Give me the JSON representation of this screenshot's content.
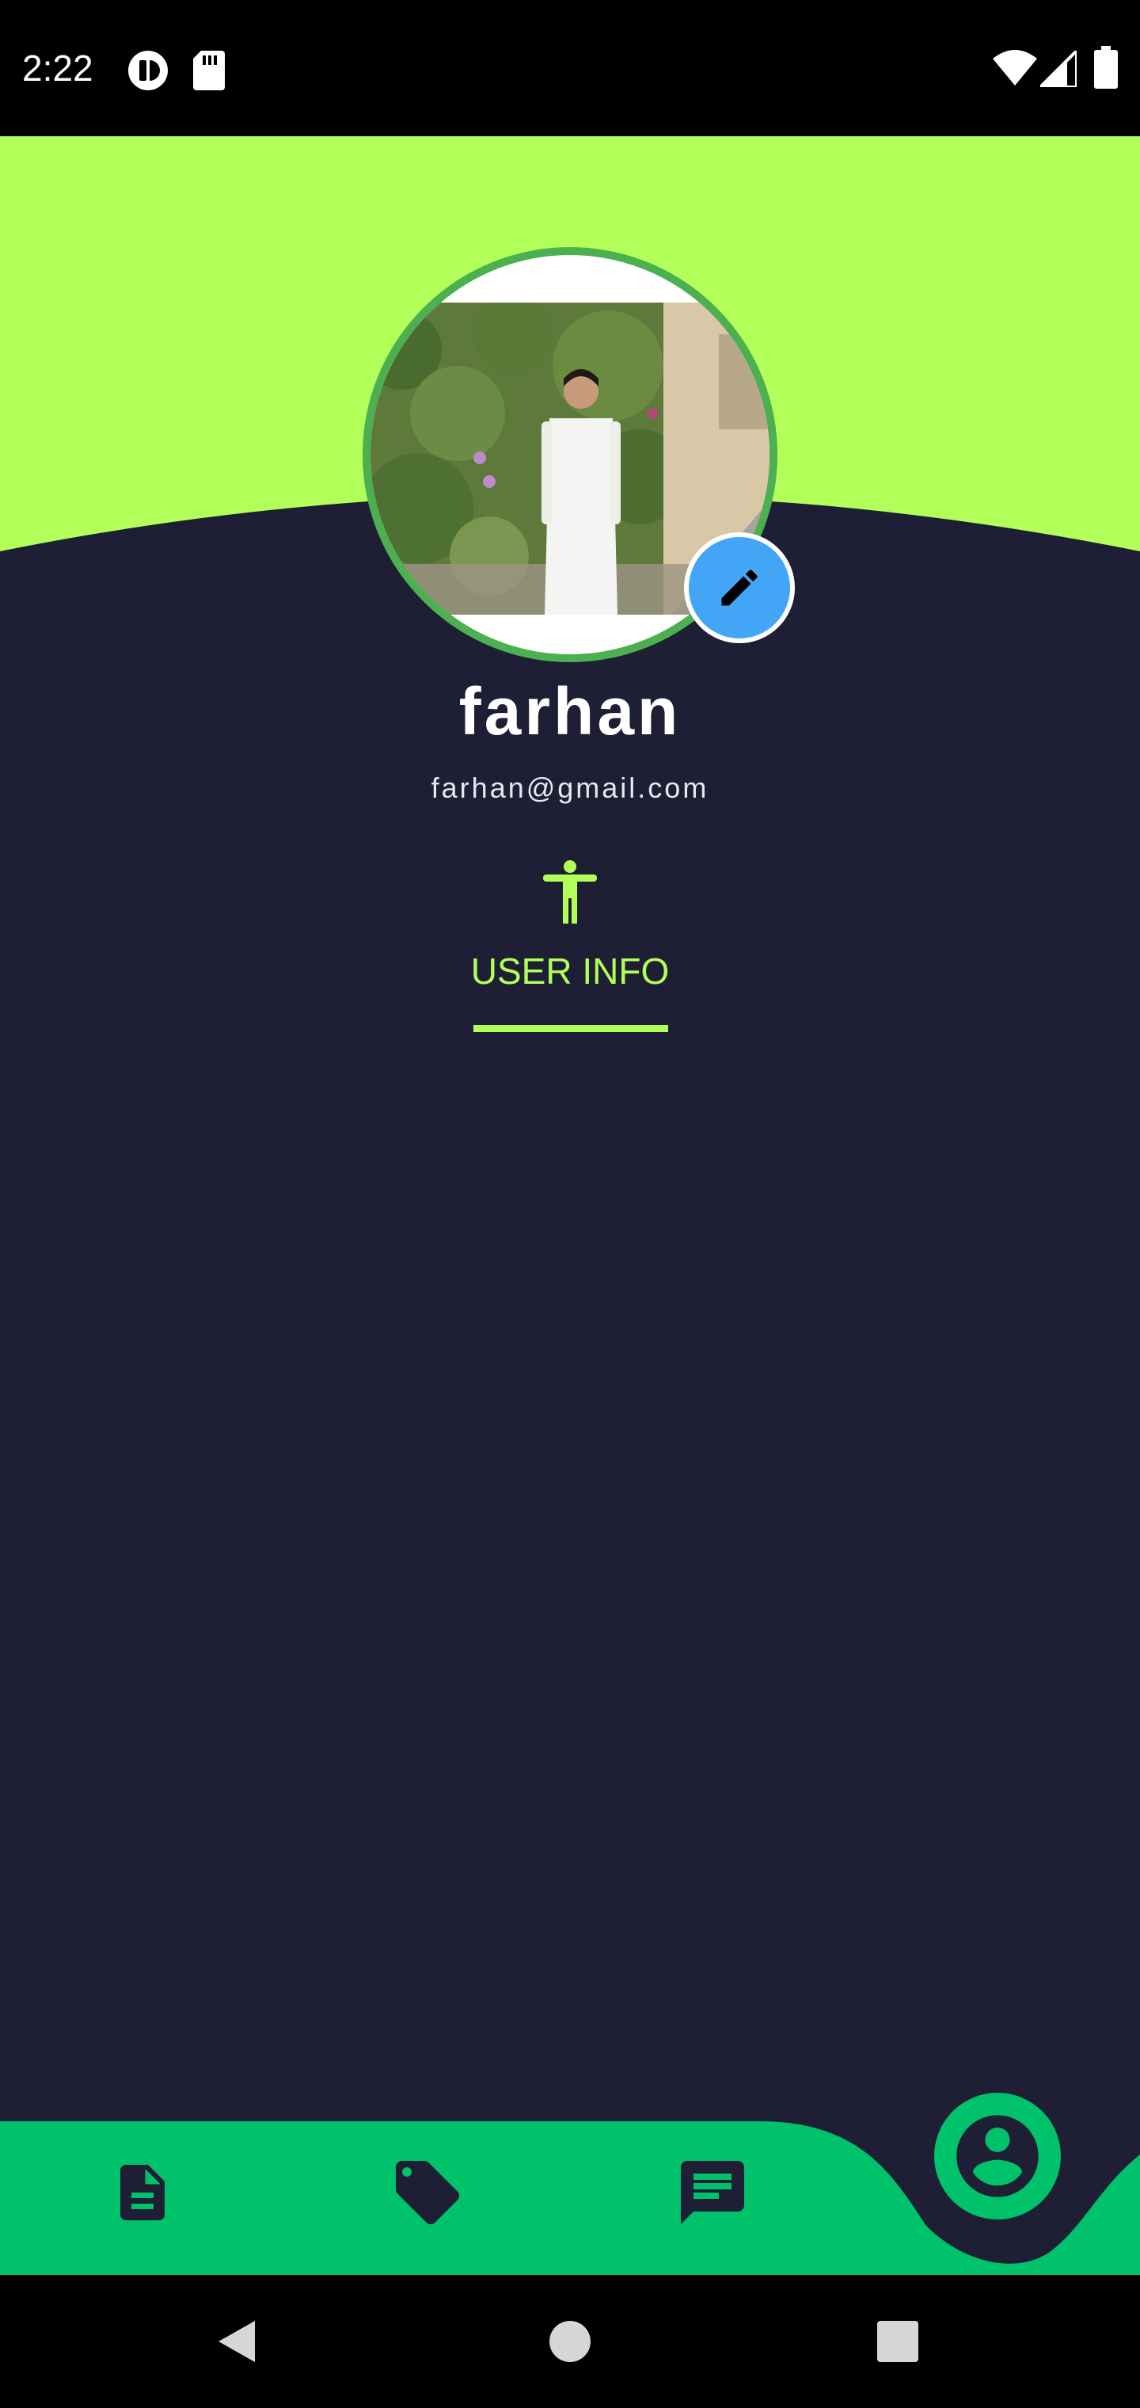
{
  "status_bar": {
    "time": "2:22",
    "left_icons": [
      "notification-circle-icon",
      "sd-card-icon"
    ],
    "right_icons": [
      "wifi-icon",
      "cell-signal-icon",
      "battery-icon"
    ]
  },
  "profile": {
    "name": "farhan",
    "email": "farhan@gmail.com",
    "avatar": "profile-photo",
    "edit_icon": "pencil-icon"
  },
  "tabs": [
    {
      "label": "USER INFO",
      "icon": "accessibility-icon",
      "selected": true
    }
  ],
  "bottom_nav": {
    "items": [
      {
        "icon": "document-icon"
      },
      {
        "icon": "tag-icon"
      },
      {
        "icon": "chat-icon"
      },
      {
        "icon": "account-circle-icon",
        "active": true
      }
    ]
  },
  "system_nav": [
    "back-icon",
    "home-icon",
    "recents-icon"
  ],
  "colors": {
    "header": "#b2ff59",
    "background": "#1e1e35",
    "accent_green": "#00c26a",
    "avatar_border": "#4caf50",
    "edit_button": "#42a5f5",
    "tab_label": "#b2ff59"
  }
}
